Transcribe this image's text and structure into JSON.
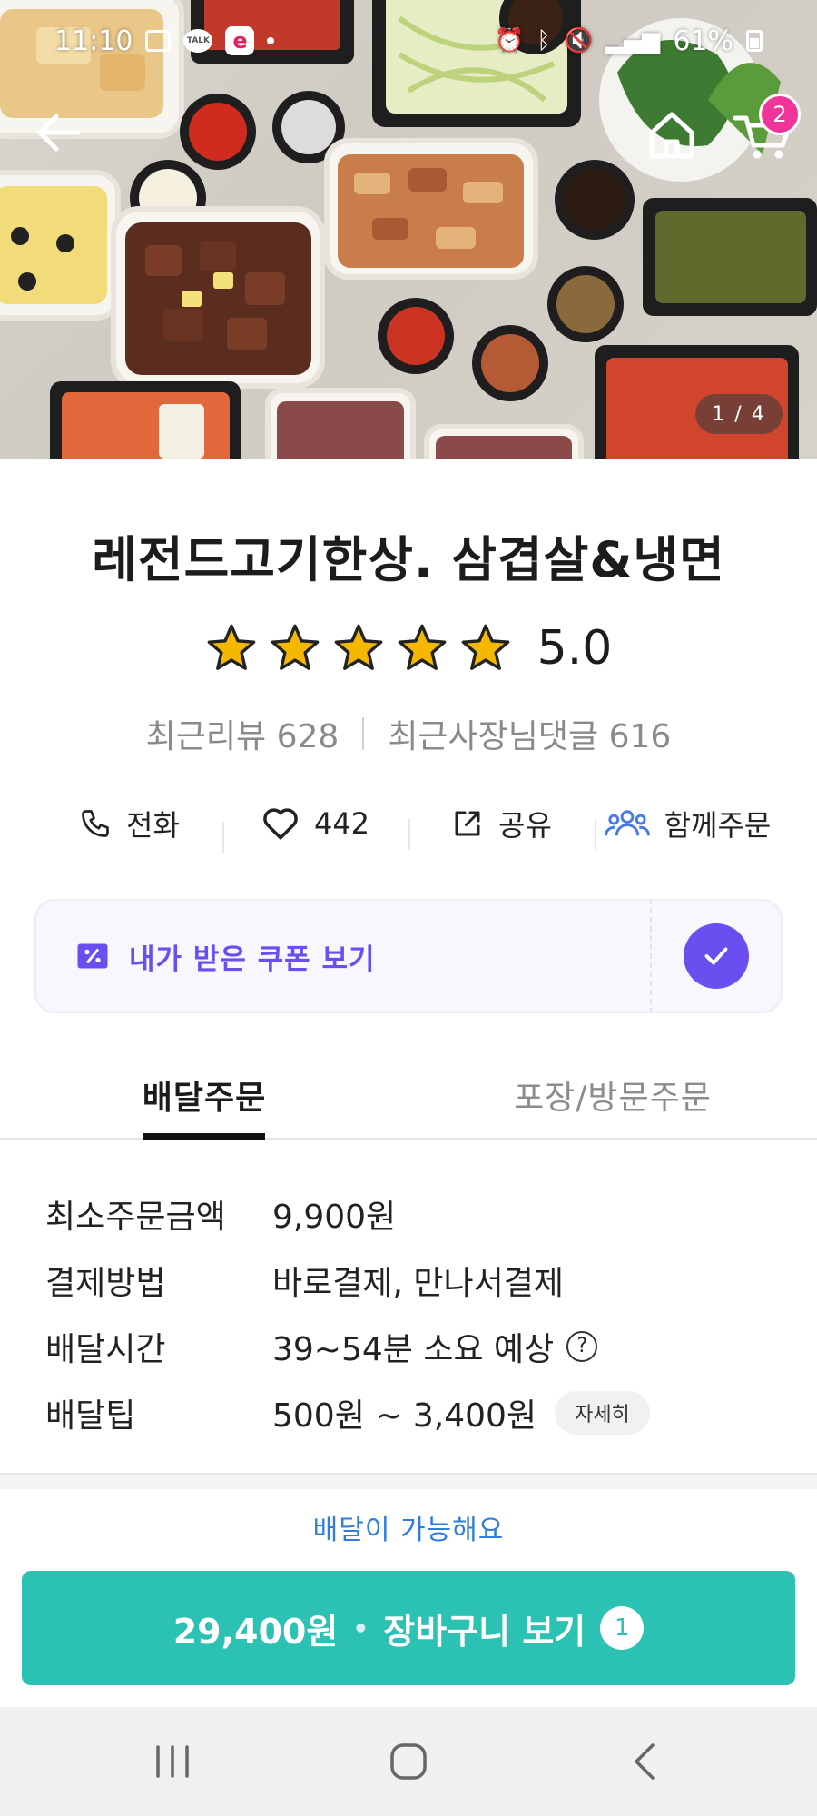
{
  "status_bar": {
    "time": "11:10",
    "talk_label": "TALK",
    "e_label": "e",
    "battery": "61%"
  },
  "hero": {
    "page_indicator": "1 / 4",
    "cart_badge": "2"
  },
  "store": {
    "name": "레전드고기한상. 삼겹살&냉면",
    "rating": "5.0",
    "stars": 5,
    "recent_reviews": "최근리뷰 628",
    "owner_replies": "최근사장님댓글 616"
  },
  "actions": {
    "call": "전화",
    "likes": "442",
    "share": "공유",
    "group_order": "함께주문"
  },
  "coupon": {
    "label": "내가 받은 쿠폰 보기"
  },
  "tabs": [
    {
      "label": "배달주문",
      "active": true
    },
    {
      "label": "포장/방문주문",
      "active": false
    }
  ],
  "delivery_info": {
    "rows": [
      {
        "label": "최소주문금액",
        "value": "9,900원"
      },
      {
        "label": "결제방법",
        "value": "바로결제, 만나서결제"
      },
      {
        "label": "배달시간",
        "value": "39~54분 소요 예상"
      },
      {
        "label": "배달팁",
        "value": "500원 ~ 3,400원"
      }
    ],
    "help_icon": "?",
    "detail_button": "자세히"
  },
  "delivery_available": "배달이 가능해요",
  "cart_cta": {
    "price": "29,400원",
    "separator": "•",
    "label": "장바구니 보기",
    "count": "1"
  },
  "colors": {
    "accent_purple": "#6a4ef0",
    "cta_teal": "#2bc1b3",
    "badge_pink": "#f0349a",
    "link_blue": "#2f7de1",
    "star_yellow": "#f5b800"
  }
}
